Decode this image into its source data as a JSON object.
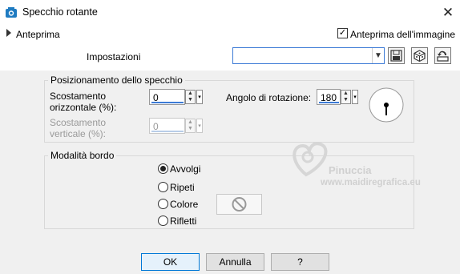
{
  "window": {
    "title": "Specchio rotante",
    "close_glyph": "✕"
  },
  "preview": {
    "label": "Anteprima",
    "image_preview_label": "Anteprima dell'immagine",
    "image_preview_checked": true
  },
  "settings": {
    "label": "Impostazioni",
    "preset_value": ""
  },
  "mirror_group": {
    "title": "Posizionamento dello specchio",
    "h_offset_label_1": "Scostamento",
    "h_offset_label_2": "orizzontale (%):",
    "h_offset_value": "0",
    "v_offset_label_1": "Scostamento",
    "v_offset_label_2": "verticale (%):",
    "v_offset_value": "0",
    "rotation_label": "Angolo di rotazione:",
    "rotation_value": "180"
  },
  "edge_group": {
    "title": "Modalità bordo",
    "options": [
      "Avvolgi",
      "Ripeti",
      "Colore",
      "Rifletti"
    ],
    "selected": "Avvolgi"
  },
  "watermark": {
    "line1": "Pinuccia",
    "line2": "www.maidiregrafica.eu"
  },
  "buttons": {
    "ok": "OK",
    "cancel": "Annulla",
    "help": "?"
  },
  "icons": [
    "app-icon",
    "close-icon",
    "expand-arrow-icon",
    "dropdown-arrow-icon",
    "save-preset-icon",
    "preset-cube-icon",
    "reset-icon",
    "spin-arrows-icon",
    "rotation-dial-icon",
    "no-color-icon"
  ]
}
